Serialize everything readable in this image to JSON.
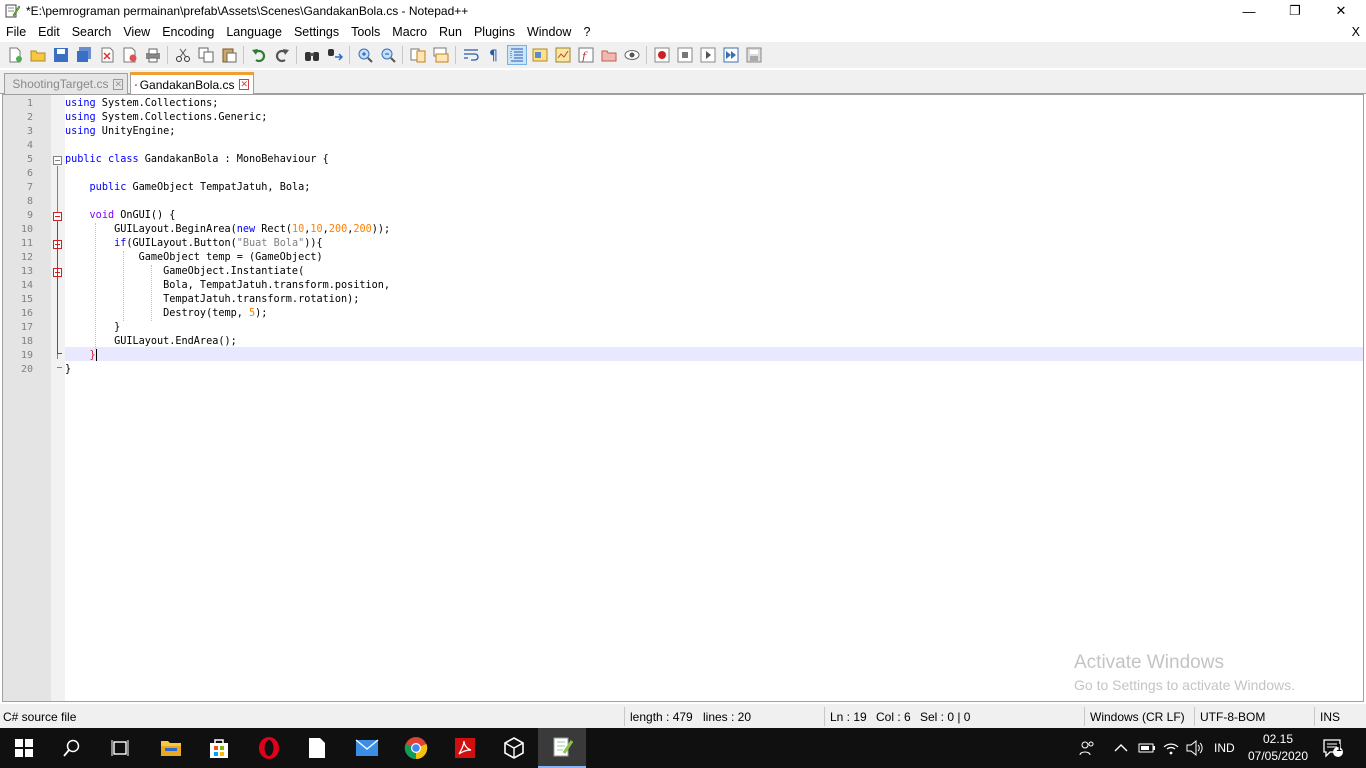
{
  "window": {
    "title": "*E:\\pemrograman permainan\\prefab\\Assets\\Scenes\\GandakanBola.cs - Notepad++",
    "minimize_glyph": "—",
    "restore_glyph": "❐",
    "close_glyph": "✕"
  },
  "menu": {
    "items": [
      "File",
      "Edit",
      "Search",
      "View",
      "Encoding",
      "Language",
      "Settings",
      "Tools",
      "Macro",
      "Run",
      "Plugins",
      "Window",
      "?"
    ],
    "close_doc": "X"
  },
  "tabs": [
    {
      "label": "ShootingTarget.cs",
      "active": false
    },
    {
      "label": "GandakanBola.cs",
      "active": true
    }
  ],
  "editor": {
    "line_numbers": [
      "1",
      "2",
      "3",
      "4",
      "5",
      "6",
      "7",
      "8",
      "9",
      "10",
      "11",
      "12",
      "13",
      "14",
      "15",
      "16",
      "17",
      "18",
      "19",
      "20"
    ],
    "current_line": 19
  },
  "watermark": {
    "line1": "Activate Windows",
    "line2": "Go to Settings to activate Windows."
  },
  "status": {
    "file_type": "C# source file",
    "length": "length : 479",
    "lines": "lines : 20",
    "ln": "Ln : 19",
    "col": "Col : 6",
    "sel": "Sel : 0 | 0",
    "eol": "Windows (CR LF)",
    "encoding": "UTF-8-BOM",
    "mode": "INS"
  },
  "taskbar": {
    "lang": "IND",
    "time": "02.15",
    "date": "07/05/2020",
    "notif_count": "1"
  },
  "colors": {
    "keyword": "#0000ff",
    "type_keyword": "#8000ff",
    "number": "#ff8000",
    "string": "#808080",
    "tab_accent": "#f0a030",
    "current_line": "#e8e8ff"
  }
}
